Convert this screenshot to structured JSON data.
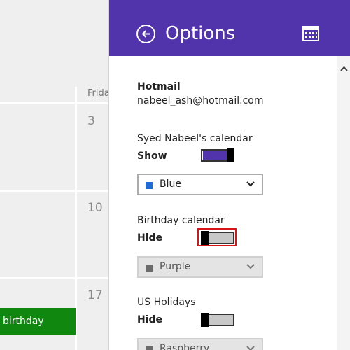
{
  "calendar": {
    "day_header": "Frida",
    "day_numbers": [
      "3",
      "10",
      "17"
    ],
    "event_label": "birthday",
    "event_color": "#108810"
  },
  "options": {
    "title": "Options",
    "back_icon": "back-arrow-icon",
    "calendar_icon": "calendar-icon",
    "header_color": "#5133ab",
    "account": {
      "name": "Hotmail",
      "email": "nabeel_ash@hotmail.com"
    },
    "calendars": [
      {
        "name": "Syed Nabeel's calendar",
        "state_label": "Show",
        "toggle_on": true,
        "color_name": "Blue",
        "color_hex": "#1e6bd6",
        "dropdown_enabled": true
      },
      {
        "name": "Birthday calendar",
        "state_label": "Hide",
        "toggle_on": false,
        "focused": true,
        "color_name": "Purple",
        "color_hex": "#6b6b6b",
        "dropdown_enabled": false
      },
      {
        "name": "US Holidays",
        "state_label": "Hide",
        "toggle_on": false,
        "color_name": "Raspberry",
        "color_hex": "#6b6b6b",
        "dropdown_enabled": false
      }
    ]
  }
}
